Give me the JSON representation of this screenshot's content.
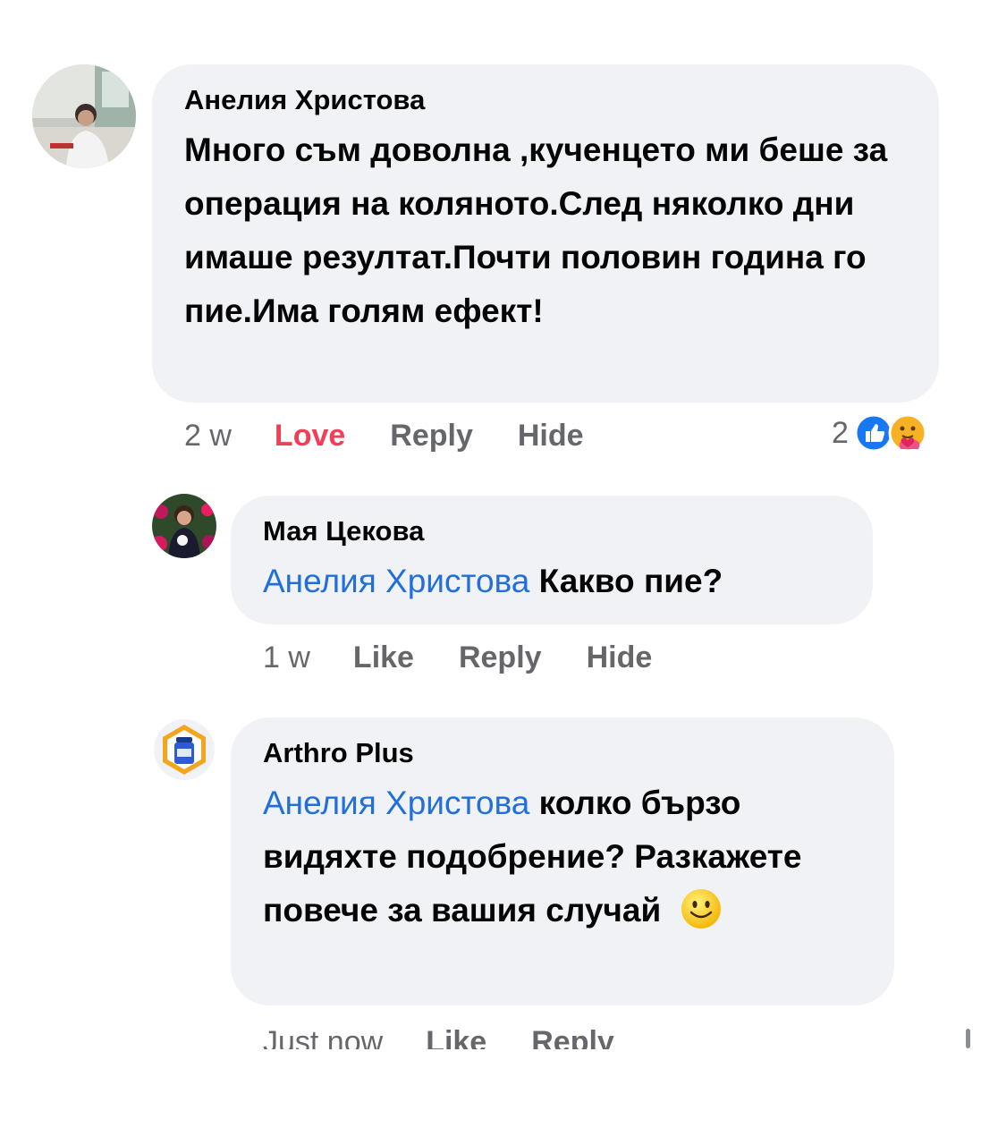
{
  "comments": [
    {
      "author": "Анелия Христова",
      "text": "Много съм доволна ,кученцето ми беше за операция на коляното.След няколко дни имаше резултат.Почти половин година го пие.Има голям ефект!",
      "time": "2 w",
      "actions": [
        "Love",
        "Reply",
        "Hide"
      ],
      "reaction_count": "2",
      "reactions": [
        "like-icon",
        "care-icon"
      ]
    },
    {
      "author": "Мая Цекова",
      "mention": "Анелия Христова",
      "text": " Какво пие?",
      "time": "1 w",
      "actions": [
        "Like",
        "Reply",
        "Hide"
      ]
    },
    {
      "author": "Arthro Plus",
      "mention": "Анелия Христова",
      "text": " колко бързо видяхте подобрение? Разкажете повече за вашия случай",
      "emoji": "smile-emoji-icon",
      "time": "Just now",
      "actions": [
        "Like",
        "Reply"
      ]
    }
  ],
  "colors": {
    "bubble": "#f0f2f5",
    "mention": "#216fdb",
    "love": "#f33e58",
    "secondary_text": "#65676b",
    "like_blue": "#1877f2"
  }
}
